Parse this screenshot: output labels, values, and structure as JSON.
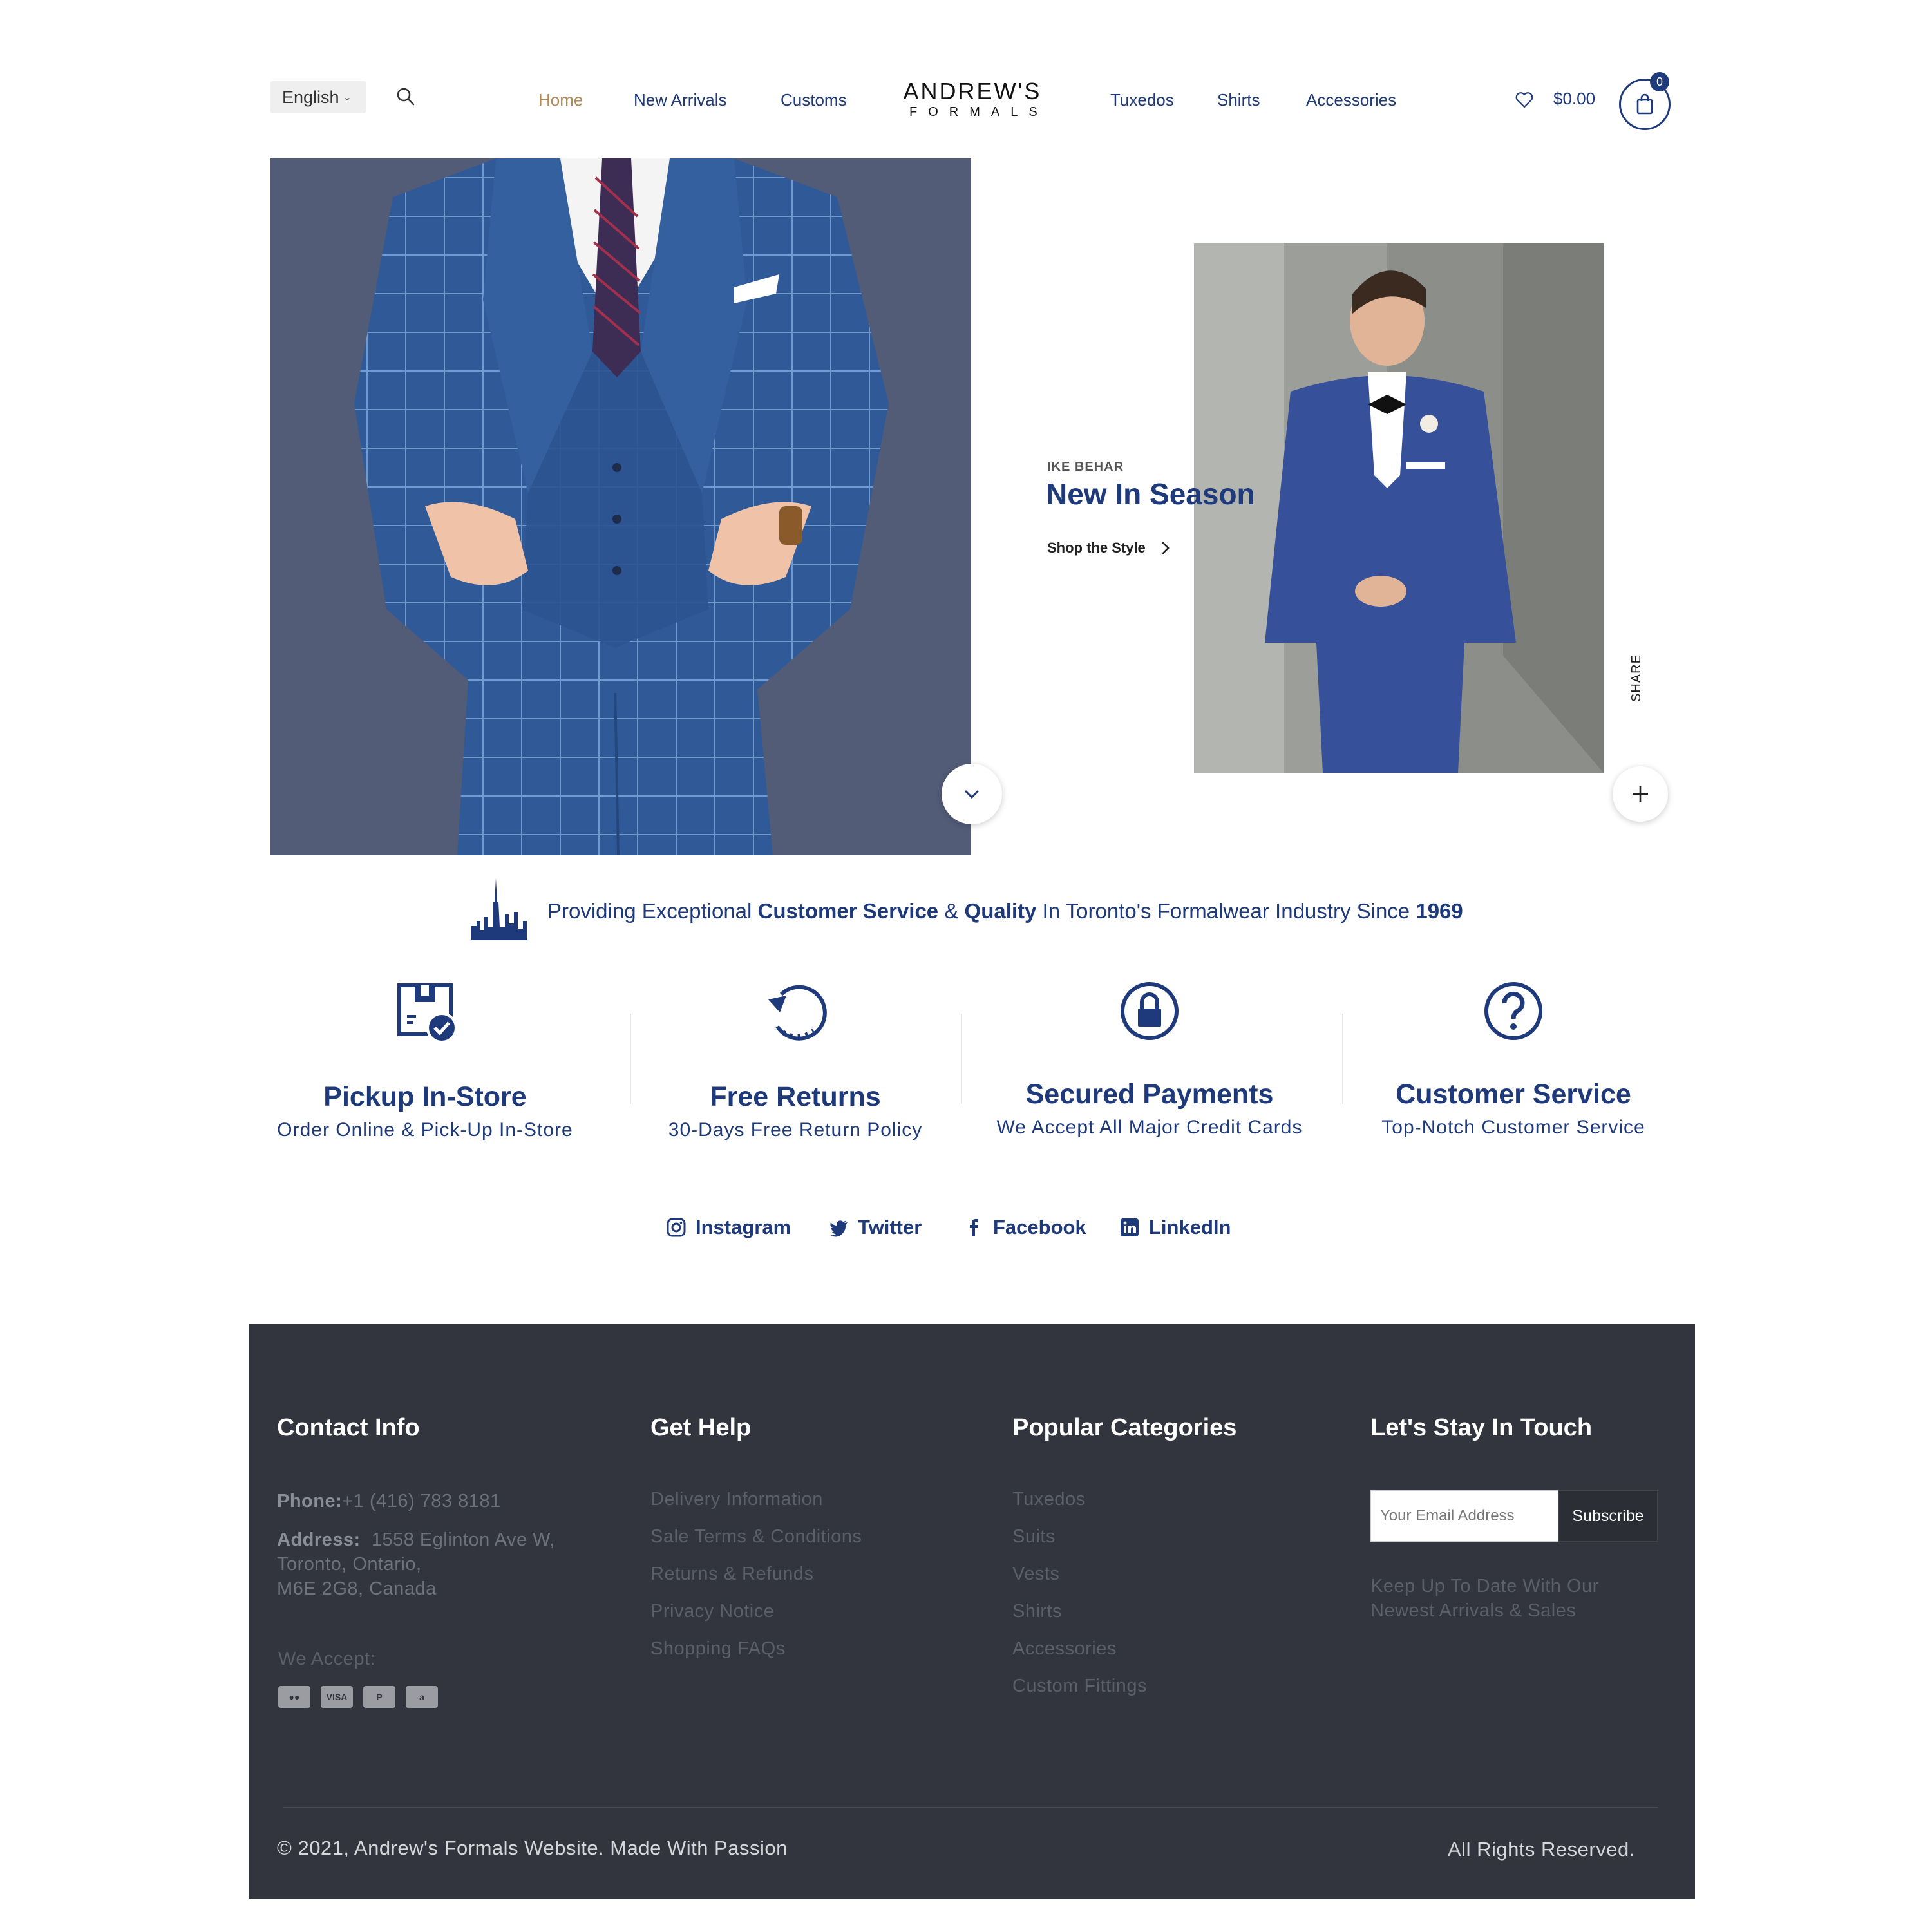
{
  "header": {
    "language": "English",
    "nav_left": [
      "Home",
      "New Arrivals",
      "Customs"
    ],
    "nav_right": [
      "Tuxedos",
      "Shirts",
      "Accessories"
    ],
    "logo_line1": "ANDREW'S",
    "logo_line2": "FORMALS",
    "cart_total": "$0.00",
    "cart_count": "0",
    "active_nav": "Home",
    "accent_color": "#1f3a7a",
    "active_color": "#b08a57"
  },
  "hero": {
    "brand": "IKE BEHAR",
    "title": "New In Season",
    "cta": "Shop the Style",
    "share_label": "SHARE"
  },
  "tagline": {
    "part1": "Providing Exceptional ",
    "bold1": "Customer Service",
    "part2": " & ",
    "bold2": "Quality",
    "part3": " In Toronto's Formalwear Industry Since ",
    "bold3": "1969"
  },
  "features": [
    {
      "title": "Pickup In-Store",
      "subtitle": "Order Online & Pick-Up In-Store",
      "icon": "store-pickup-icon"
    },
    {
      "title": "Free Returns",
      "subtitle": "30-Days Free Return Policy",
      "icon": "return-icon"
    },
    {
      "title": "Secured Payments",
      "subtitle": "We Accept All Major Credit Cards",
      "icon": "lock-icon"
    },
    {
      "title": "Customer Service",
      "subtitle": "Top-Notch Customer Service",
      "icon": "question-icon"
    }
  ],
  "social": [
    "Instagram",
    "Twitter",
    "Facebook",
    "LinkedIn"
  ],
  "footer": {
    "contact_title": "Contact Info",
    "phone_label": "Phone:",
    "phone": "+1 (416) 783 8181",
    "address_label": "Address:",
    "address_line1": "1558 Eglinton Ave W,",
    "address_line2": "Toronto, Ontario,",
    "address_line3": "M6E 2G8, Canada",
    "we_accept": "We Accept:",
    "payments": [
      "mastercard",
      "VISA",
      "P",
      "a"
    ],
    "help_title": "Get Help",
    "help_links": [
      "Delivery Information",
      "Sale Terms & Conditions",
      "Returns & Refunds",
      "Privacy Notice",
      "Shopping FAQs"
    ],
    "categories_title": "Popular Categories",
    "category_links": [
      "Tuxedos",
      "Suits",
      "Vests",
      "Shirts",
      "Accessories",
      "Custom Fittings"
    ],
    "touch_title": "Let's Stay In Touch",
    "email_placeholder": "Your Email Address",
    "subscribe_label": "Subscribe",
    "keep_line1": "Keep Up To Date With Our",
    "keep_line2": "Newest Arrivals & Sales",
    "copyright": "© 2021, Andrew's Formals Website. Made With Passion",
    "rights": "All Rights Reserved."
  }
}
